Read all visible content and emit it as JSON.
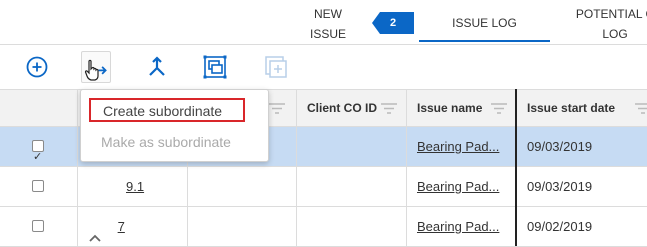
{
  "tabs": {
    "new_issue": "NEW\nISSUE",
    "step_number": "2",
    "issue_log": "ISSUE LOG",
    "potential": "POTENTIAL C\nLOG"
  },
  "toolbar": {
    "add_icon": "plus-circle-icon",
    "hierarchy_icon": "subordinate-arrow-icon",
    "merge_icon": "merge-icon",
    "group_icon": "group-frame-icon",
    "disabled_icon": "add-frame-icon"
  },
  "grid": {
    "headers": [
      "Client CO ID",
      "Issue name",
      "Issue start date"
    ],
    "rows": [
      {
        "checked": true,
        "id": "",
        "client_co_id": "",
        "issue_name": "Bearing Pad...",
        "start_date": "09/03/2019"
      },
      {
        "checked": false,
        "id": "9.1",
        "client_co_id": "",
        "issue_name": "Bearing Pad...",
        "start_date": "09/03/2019"
      },
      {
        "checked": false,
        "id": "7",
        "client_co_id": "",
        "issue_name": "Bearing Pad...",
        "start_date": "09/02/2019"
      }
    ]
  },
  "menu": {
    "create_subordinate": "Create subordinate",
    "make_as_subordinate": "Make as subordinate"
  },
  "colors": {
    "accent": "#0b67c6",
    "highlight_border": "#d9262a",
    "selected_row": "#c6dbf3"
  }
}
